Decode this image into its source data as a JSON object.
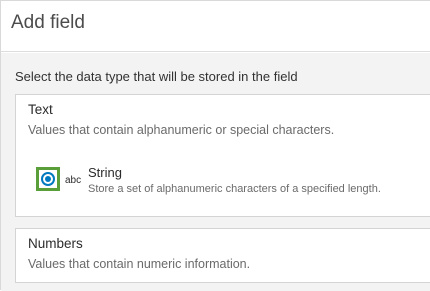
{
  "dialog": {
    "title": "Add field"
  },
  "prompt": "Select the data type that will be stored in the field",
  "categories": [
    {
      "title": "Text",
      "description": "Values that contain alphanumeric or special characters.",
      "options": [
        {
          "icon": "abc",
          "label": "String",
          "description": "Store a set of alphanumeric characters of a specified length.",
          "selected": true
        }
      ]
    },
    {
      "title": "Numbers",
      "description": "Values that contain numeric information."
    }
  ],
  "colors": {
    "accent": "#0079c1",
    "highlight": "#5a9e3a",
    "body_background": "#f3f3f3"
  }
}
